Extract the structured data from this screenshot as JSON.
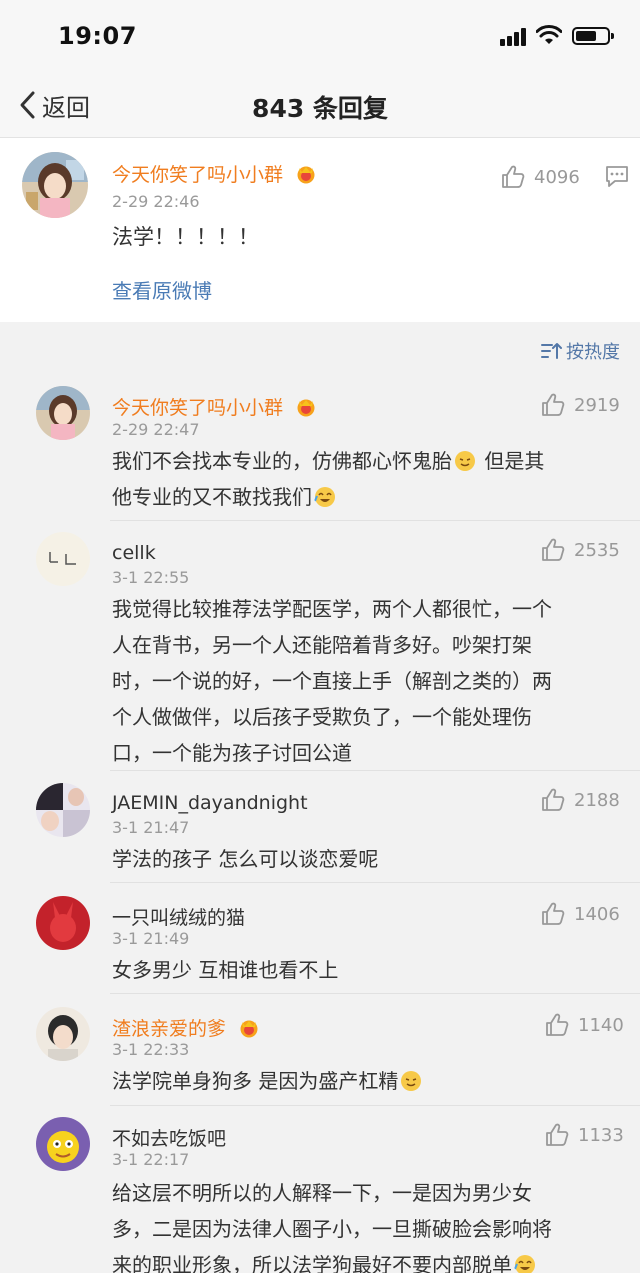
{
  "status": {
    "time": "19:07"
  },
  "nav": {
    "back_label": "返回",
    "title": "843 条回复"
  },
  "original": {
    "username": "今天你笑了吗小小群",
    "time": "2-29 22:46",
    "likes": "4096",
    "text": "法学！！！！！",
    "view_original": "查看原微博"
  },
  "sort": {
    "label": "按热度"
  },
  "comments": [
    {
      "username": "今天你笑了吗小小群",
      "time": "2-29 22:47",
      "likes": "2919",
      "lines": [
        "我们不会找本专业的，仿佛都心怀鬼胎",
        "他专业的又不敢找我们"
      ],
      "line1_tail": "但是其"
    },
    {
      "username": "cellk",
      "time": "3-1 22:55",
      "likes": "2535",
      "lines": [
        "我觉得比较推荐法学配医学，两个人都很忙，一个",
        "人在背书，另一个人还能陪着背多好。吵架打架",
        "时，一个说的好，一个直接上手（解剖之类的）两",
        "个人做做伴，以后孩子受欺负了，一个能处理伤",
        "口，一个能为孩子讨回公道"
      ]
    },
    {
      "username": "JAEMIN_dayandnight",
      "time": "3-1 21:47",
      "likes": "2188",
      "lines": [
        "学法的孩子 怎么可以谈恋爱呢"
      ]
    },
    {
      "username": "一只叫绒绒的猫",
      "time": "3-1 21:49",
      "likes": "1406",
      "lines": [
        "女多男少 互相谁也看不上"
      ]
    },
    {
      "username": "渣浪亲爱的爹",
      "time": "3-1 22:33",
      "likes": "1140",
      "lines": [
        "法学院单身狗多 是因为盛产杠精"
      ]
    },
    {
      "username": "不如去吃饭吧",
      "time": "3-1 22:17",
      "likes": "1133",
      "lines": [
        "给这层不明所以的人解释一下，一是因为男少女",
        "多，二是因为法律人圈子小，一旦撕破脸会影响将",
        "来的职业形象，所以法学狗最好不要内部脱单"
      ]
    }
  ],
  "colors": {
    "accent_orange": "#f07d1f",
    "link_blue": "#4a7bb5"
  },
  "icons": [
    "back-chevron-icon",
    "signal-icon",
    "wifi-icon",
    "battery-icon",
    "thumb-up-icon",
    "reply-icon",
    "sort-icon",
    "vip-crown-icon",
    "emoji-icon"
  ]
}
